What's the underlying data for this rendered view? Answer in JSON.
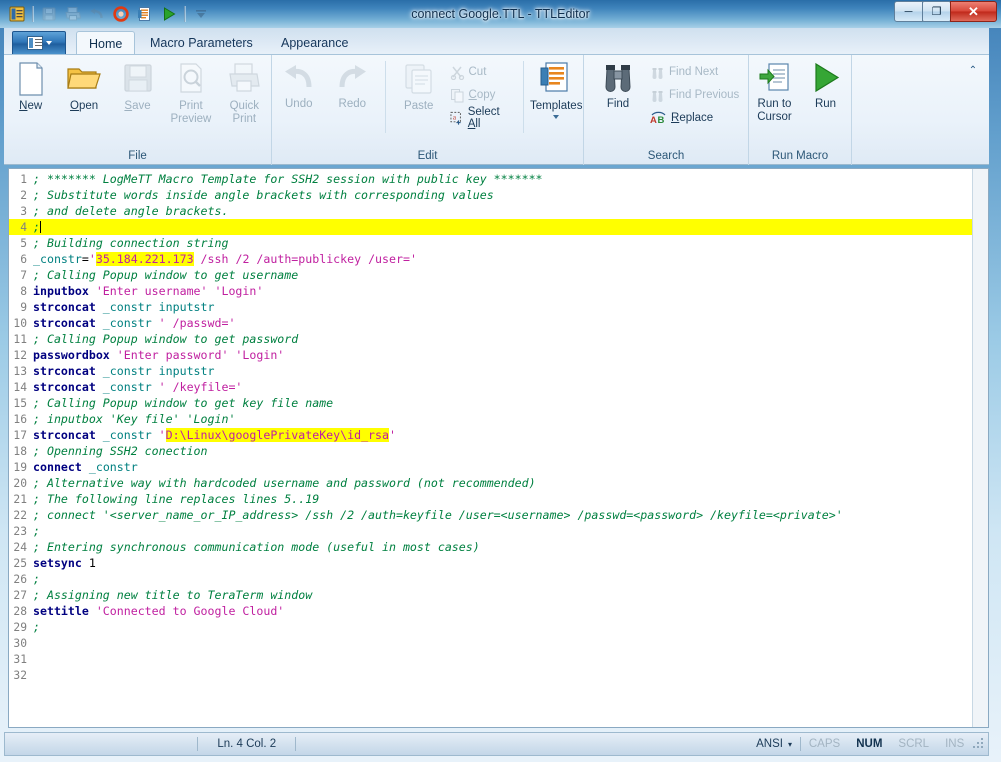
{
  "window": {
    "title": "connect Google.TTL - TTLEditor",
    "controls": {
      "minimize": "─",
      "maximize": "❐",
      "close": "✕"
    }
  },
  "quick_access": {
    "items": [
      {
        "name": "app-icon",
        "icon": "app-icon",
        "enabled": true
      },
      {
        "name": "save",
        "icon": "save-icon",
        "enabled": false
      },
      {
        "name": "print",
        "icon": "print-icon",
        "enabled": false
      },
      {
        "name": "undo",
        "icon": "undo-icon",
        "enabled": false
      },
      {
        "name": "stop",
        "icon": "stop-record-icon",
        "enabled": true
      },
      {
        "name": "templates",
        "icon": "templates-icon",
        "enabled": true
      },
      {
        "name": "run",
        "icon": "run-icon",
        "enabled": true
      },
      {
        "name": "customize",
        "icon": "chevron-down-icon",
        "enabled": true
      }
    ]
  },
  "ribbon": {
    "app_button": "app-menu-button",
    "tabs": [
      {
        "label": "Home",
        "active": true
      },
      {
        "label": "Macro Parameters",
        "active": false
      },
      {
        "label": "Appearance",
        "active": false
      }
    ],
    "minimize_hint": "⌃",
    "groups": [
      {
        "label": "File",
        "buttons": [
          {
            "label": "New",
            "underline": "N",
            "icon": "new-document-icon",
            "enabled": true
          },
          {
            "label": "Open",
            "underline": "O",
            "icon": "open-folder-icon",
            "enabled": true
          },
          {
            "label": "Save",
            "underline": "S",
            "icon": "floppy-disk-icon",
            "enabled": false
          },
          {
            "label": "Print\nPreview",
            "icon": "print-preview-icon",
            "enabled": false
          },
          {
            "label": "Quick\nPrint",
            "icon": "quick-print-icon",
            "enabled": false
          }
        ]
      },
      {
        "label": "Edit",
        "buttons": [
          {
            "label": "Undo",
            "icon": "undo-arrow-icon",
            "enabled": false
          },
          {
            "label": "Redo",
            "icon": "redo-arrow-icon",
            "enabled": false
          },
          {
            "label": "Paste",
            "icon": "clipboard-icon",
            "enabled": false
          }
        ],
        "small_buttons": [
          {
            "label": "Cut",
            "icon": "scissors-icon",
            "enabled": false
          },
          {
            "label": "Copy",
            "underline": "C",
            "icon": "copy-icon",
            "enabled": false
          },
          {
            "label": "Select All",
            "underline": "A",
            "icon": "select-all-icon",
            "enabled": true
          }
        ],
        "extra_buttons": [
          {
            "label": "Templates",
            "icon": "templates-icon",
            "enabled": true,
            "dropdown": true
          }
        ]
      },
      {
        "label": "Search",
        "buttons": [
          {
            "label": "Find",
            "icon": "binoculars-icon",
            "enabled": true
          }
        ],
        "small_buttons": [
          {
            "label": "Find Next",
            "icon": "find-next-icon",
            "enabled": false
          },
          {
            "label": "Find Previous",
            "icon": "find-previous-icon",
            "enabled": false
          },
          {
            "label": "Replace",
            "underline": "R",
            "icon": "replace-icon",
            "enabled": true
          }
        ]
      },
      {
        "label": "Run Macro",
        "buttons": [
          {
            "label": "Run to\nCursor",
            "icon": "run-to-cursor-icon",
            "enabled": true
          },
          {
            "label": "Run",
            "icon": "run-play-icon",
            "enabled": true
          }
        ]
      }
    ]
  },
  "editor": {
    "current_line": 4,
    "total_visible_lines": 32,
    "lines": [
      {
        "n": 1,
        "tokens": [
          {
            "t": "cm",
            "s": "; ******* LogMeTT Macro Template for SSH2 session with public key *******"
          }
        ]
      },
      {
        "n": 2,
        "tokens": [
          {
            "t": "cm",
            "s": "; Substitute words inside angle brackets with corresponding values"
          }
        ]
      },
      {
        "n": 3,
        "tokens": [
          {
            "t": "cm",
            "s": "; and delete angle brackets."
          }
        ]
      },
      {
        "n": 4,
        "highlight": true,
        "caret": true,
        "tokens": [
          {
            "t": "cm",
            "s": ";"
          }
        ]
      },
      {
        "n": 5,
        "tokens": [
          {
            "t": "cm",
            "s": "; Building connection string"
          }
        ]
      },
      {
        "n": 6,
        "tokens": [
          {
            "t": "var",
            "s": "_constr"
          },
          {
            "t": "pl",
            "s": "="
          },
          {
            "t": "str",
            "s": "'"
          },
          {
            "t": "str mark",
            "s": "35.184.221.173"
          },
          {
            "t": "str",
            "s": " /ssh /2 /auth=publickey /user='"
          }
        ]
      },
      {
        "n": 7,
        "tokens": [
          {
            "t": "cm",
            "s": "; Calling Popup window to get username"
          }
        ]
      },
      {
        "n": 8,
        "tokens": [
          {
            "t": "kw",
            "s": "inputbox"
          },
          {
            "t": "str",
            "s": " 'Enter username' 'Login'"
          }
        ]
      },
      {
        "n": 9,
        "tokens": [
          {
            "t": "kw",
            "s": "strconcat"
          },
          {
            "t": "var",
            "s": " _constr inputstr"
          }
        ]
      },
      {
        "n": 10,
        "tokens": [
          {
            "t": "kw",
            "s": "strconcat"
          },
          {
            "t": "var",
            "s": " _constr"
          },
          {
            "t": "str",
            "s": " ' /passwd='"
          }
        ]
      },
      {
        "n": 11,
        "tokens": [
          {
            "t": "cm",
            "s": "; Calling Popup window to get password"
          }
        ]
      },
      {
        "n": 12,
        "tokens": [
          {
            "t": "kw",
            "s": "passwordbox"
          },
          {
            "t": "str",
            "s": " 'Enter password' 'Login'"
          }
        ]
      },
      {
        "n": 13,
        "tokens": [
          {
            "t": "kw",
            "s": "strconcat"
          },
          {
            "t": "var",
            "s": " _constr inputstr"
          }
        ]
      },
      {
        "n": 14,
        "tokens": [
          {
            "t": "kw",
            "s": "strconcat"
          },
          {
            "t": "var",
            "s": " _constr"
          },
          {
            "t": "str",
            "s": " ' /keyfile='"
          }
        ]
      },
      {
        "n": 15,
        "tokens": [
          {
            "t": "cm",
            "s": "; Calling Popup window to get key file name"
          }
        ]
      },
      {
        "n": 16,
        "tokens": [
          {
            "t": "cm",
            "s": "; inputbox 'Key file' 'Login'"
          }
        ]
      },
      {
        "n": 17,
        "tokens": [
          {
            "t": "kw",
            "s": "strconcat"
          },
          {
            "t": "var",
            "s": " _constr"
          },
          {
            "t": "str",
            "s": " '"
          },
          {
            "t": "str mark",
            "s": "D:\\Linux\\googlePrivateKey\\id_rsa"
          },
          {
            "t": "str",
            "s": "'"
          }
        ]
      },
      {
        "n": 18,
        "tokens": [
          {
            "t": "cm",
            "s": "; Openning SSH2 conection"
          }
        ]
      },
      {
        "n": 19,
        "tokens": [
          {
            "t": "kw",
            "s": "connect"
          },
          {
            "t": "var",
            "s": " _constr"
          }
        ]
      },
      {
        "n": 20,
        "tokens": [
          {
            "t": "cm",
            "s": "; Alternative way with hardcoded username and password (not recommended)"
          }
        ]
      },
      {
        "n": 21,
        "tokens": [
          {
            "t": "cm",
            "s": "; The following line replaces lines 5..19"
          }
        ]
      },
      {
        "n": 22,
        "tokens": [
          {
            "t": "cm",
            "s": "; connect '<server_name_or_IP_address> /ssh /2 /auth=keyfile /user=<username> /passwd=<password> /keyfile=<private>'"
          }
        ]
      },
      {
        "n": 23,
        "tokens": [
          {
            "t": "cm",
            "s": ";"
          }
        ]
      },
      {
        "n": 24,
        "tokens": [
          {
            "t": "cm",
            "s": "; Entering synchronous communication mode (useful in most cases)"
          }
        ]
      },
      {
        "n": 25,
        "tokens": [
          {
            "t": "kw",
            "s": "setsync"
          },
          {
            "t": "pl",
            "s": " 1"
          }
        ]
      },
      {
        "n": 26,
        "tokens": [
          {
            "t": "cm",
            "s": ";"
          }
        ]
      },
      {
        "n": 27,
        "tokens": [
          {
            "t": "cm",
            "s": "; Assigning new title to TeraTerm window"
          }
        ]
      },
      {
        "n": 28,
        "tokens": [
          {
            "t": "kw",
            "s": "settitle"
          },
          {
            "t": "str",
            "s": " 'Connected to Google Cloud'"
          }
        ]
      },
      {
        "n": 29,
        "tokens": [
          {
            "t": "cm",
            "s": ";"
          }
        ]
      },
      {
        "n": 30,
        "tokens": []
      },
      {
        "n": 31,
        "tokens": []
      },
      {
        "n": 32,
        "tokens": []
      }
    ]
  },
  "statusbar": {
    "position": "Ln. 4  Col. 2",
    "encoding": "ANSI",
    "encoding_caret": "▾",
    "indicators": [
      {
        "label": "CAPS",
        "active": false
      },
      {
        "label": "NUM",
        "active": true
      },
      {
        "label": "SCRL",
        "active": false
      },
      {
        "label": "INS",
        "active": false
      }
    ]
  },
  "colors": {
    "highlight_yellow": "#ffff00",
    "comment_green": "#008040",
    "keyword_blue": "#000080",
    "string_magenta": "#c020a0",
    "variable_teal": "#008080",
    "titlebar_blue": "#3f84bc"
  }
}
